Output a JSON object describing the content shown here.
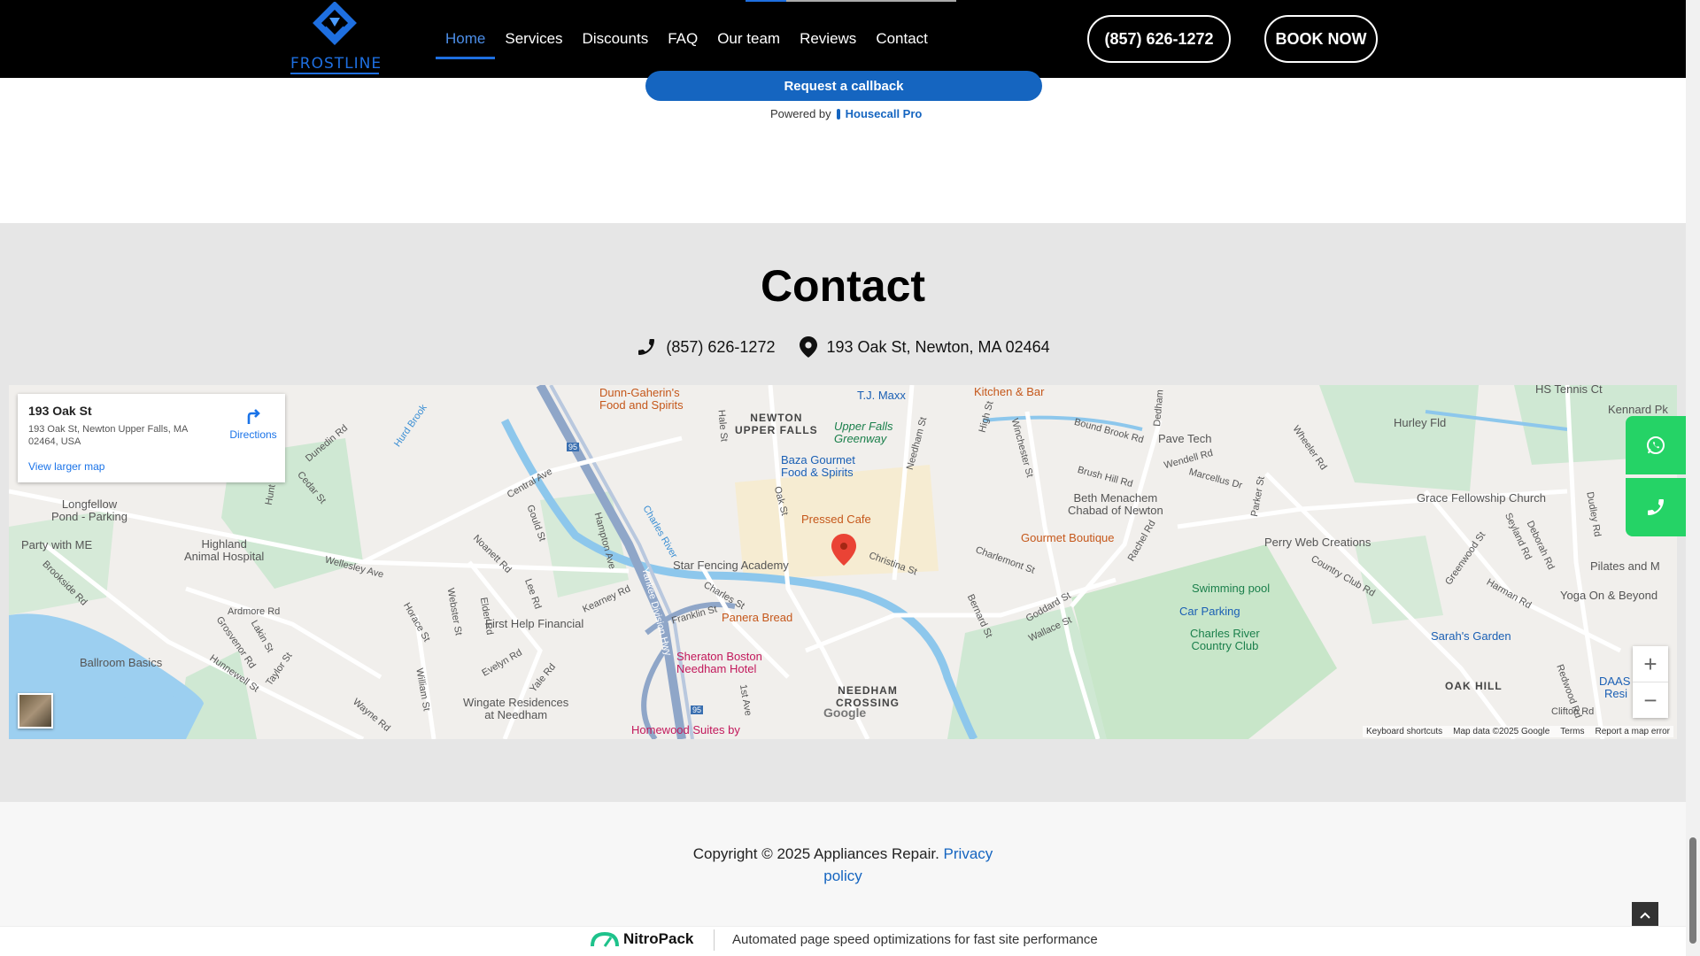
{
  "header": {
    "logo_text": "FROSTLINE",
    "nav": [
      "Home",
      "Services",
      "Discounts",
      "FAQ",
      "Our team",
      "Reviews",
      "Contact"
    ],
    "phone_button": "(857) 626-1272",
    "book_button": "BOOK NOW"
  },
  "callback": {
    "button": "Request a callback",
    "powered_by": "Powered by",
    "provider": "Housecall Pro"
  },
  "contact": {
    "title": "Contact",
    "phone": "(857) 626-1272",
    "address": "193 Oak St, Newton, MA 02464"
  },
  "map": {
    "card_name": "193 Oak St",
    "card_address": "193 Oak St, Newton Upper Falls, MA 02464, USA",
    "directions": "Directions",
    "view_larger": "View larger map",
    "google": "Google",
    "attribution": [
      "Keyboard shortcuts",
      "Map data ©2025 Google",
      "Terms",
      "Report a map error"
    ],
    "labels": {
      "dunn": "Dunn-Gaherin's\nFood and Spirits",
      "newton_upper_falls": "NEWTON\nUPPER FALLS",
      "tjmaxx": "T.J. Maxx",
      "kitchen": "Kitchen & Bar",
      "upper_falls_greenway": "Upper Falls\nGreenway",
      "baza": "Baza Gourmet\nFood & Spirits",
      "pressed_cafe": "Pressed Cafe",
      "gourmet_boutique": "Gourmet Boutique",
      "star_fencing": "Star Fencing Academy",
      "panera": "Panera Bread",
      "sheraton": "Sheraton Boston\nNeedham Hotel",
      "homewood": "Homewood Suites by",
      "needham_crossing": "NEEDHAM\nCROSSING",
      "first_help": "First Help Financial",
      "wingate": "Wingate Residences\nat Needham",
      "highland": "Highland\nAnimal Hospital",
      "party": "Party with ME",
      "longfellow": "Longfellow\nPond - Parking",
      "ballroom": "Ballroom Basics",
      "pave_tech": "Pave Tech",
      "beth_menachem": "Beth Menachem\nChabad of Newton",
      "grace": "Grace Fellowship Church",
      "perry": "Perry Web Creations",
      "swimming": "Swimming pool",
      "car_parking": "Car Parking",
      "charles_river_cc": "Charles River\nCountry Club",
      "sarahs": "Sarah's Garden",
      "oak_hill": "OAK HILL",
      "hs_tennis": "HS Tennis Ct",
      "hurley": "Hurley Fld",
      "kennard": "Kennard Pk",
      "pilates": "Pilates and M",
      "yoga": "Yoga On & Beyond",
      "daas": "DAAS",
      "resi": "Resi",
      "clifton": "Clifton Rd",
      "charles_river": "Charles River",
      "christina": "Christina St",
      "oak_st": "Oak St",
      "needham_st": "Needham St",
      "winchester": "Winchester St",
      "yankee": "Yankee Division Hwy",
      "central": "Central Ave",
      "wellesley": "Wellesley Ave",
      "ardmore": "Ardmore Rd",
      "hunnewell": "Hunnewell St",
      "cedar": "Cedar St",
      "dunedin": "Dunedin Rd",
      "hurd_brook": "Hurd Brook",
      "bound_brook": "Bound Brook Rd",
      "brush_hill": "Brush Hill Rd",
      "marcellus": "Marcellus Dr",
      "wendell": "Wendell Rd",
      "charlemont": "Charlemont St",
      "rachel": "Rachel Rd",
      "country_club": "Country Club Rd",
      "greenwood": "Greenwood St",
      "harman": "Harman Rd",
      "deborah": "Deborah Rd",
      "kearney": "Kearney Rd",
      "hampton": "Hampton Ave",
      "franklin": "Franklin St",
      "charles_st": "Charles St",
      "webster": "Webster St",
      "horace": "Horace St",
      "evelyn": "Evelyn Rd",
      "william": "William St",
      "wayne": "Wayne Rd",
      "noanett": "Noanett Rd",
      "gould": "Gould St",
      "lee": "Lee Rd",
      "elder": "Elder Rd",
      "yale": "Yale Rd",
      "bernard": "Bernard St",
      "wallace": "Wallace St",
      "goddard": "Goddard St",
      "hale": "Hale St",
      "high": "High St",
      "wheeler": "Wheeler Rd",
      "parker": "Parker St",
      "seyland": "Seyland Rd",
      "dudley": "Dudley Rd",
      "brookside": "Brookside Rd",
      "grosvenor": "Grosvenor Rd",
      "lakin": "Lakin St",
      "taylor": "Taylor St",
      "hunt": "Hunt",
      "first_ave": "1st Ave",
      "dedham": "Dedham",
      "redwood": "Redwood Rd",
      "i95_a": "95",
      "i95_b": "95"
    }
  },
  "footer": {
    "copyright": "Copyright © 2025 Appliances Repair.",
    "privacy": "Privacy policy",
    "nitro_brand": "NitroPack",
    "nitro_text": "Automated page speed optimizations for fast site performance"
  },
  "colors": {
    "brand_blue": "#1565c0",
    "whatsapp_green": "#25d366",
    "header_bg": "#000000"
  }
}
